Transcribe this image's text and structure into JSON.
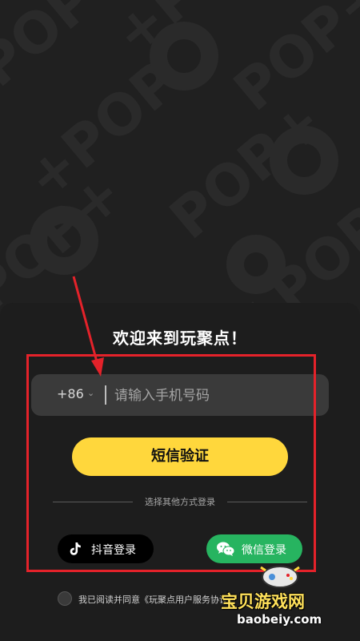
{
  "background": {
    "pattern_text": "POP",
    "color": "#202020",
    "pattern_color": "#2a2a2a"
  },
  "welcome": {
    "title": "欢迎来到玩聚点！"
  },
  "phone": {
    "country_code": "+86",
    "placeholder": "请输入手机号码",
    "value": ""
  },
  "sms_button": {
    "label": "短信验证",
    "color": "#ffd73c"
  },
  "divider": {
    "label": "选择其他方式登录"
  },
  "douyin": {
    "label": "抖音登录",
    "icon": "douyin-icon"
  },
  "wechat": {
    "label": "微信登录",
    "icon": "wechat-icon",
    "color": "#27b460"
  },
  "agreement": {
    "text": "我已阅读并同意《玩聚点用户服务协议》",
    "checked": false
  },
  "annotation": {
    "color": "#e4222a"
  },
  "watermark": {
    "title": "宝贝游戏网",
    "domain": "baobeiy.com"
  }
}
